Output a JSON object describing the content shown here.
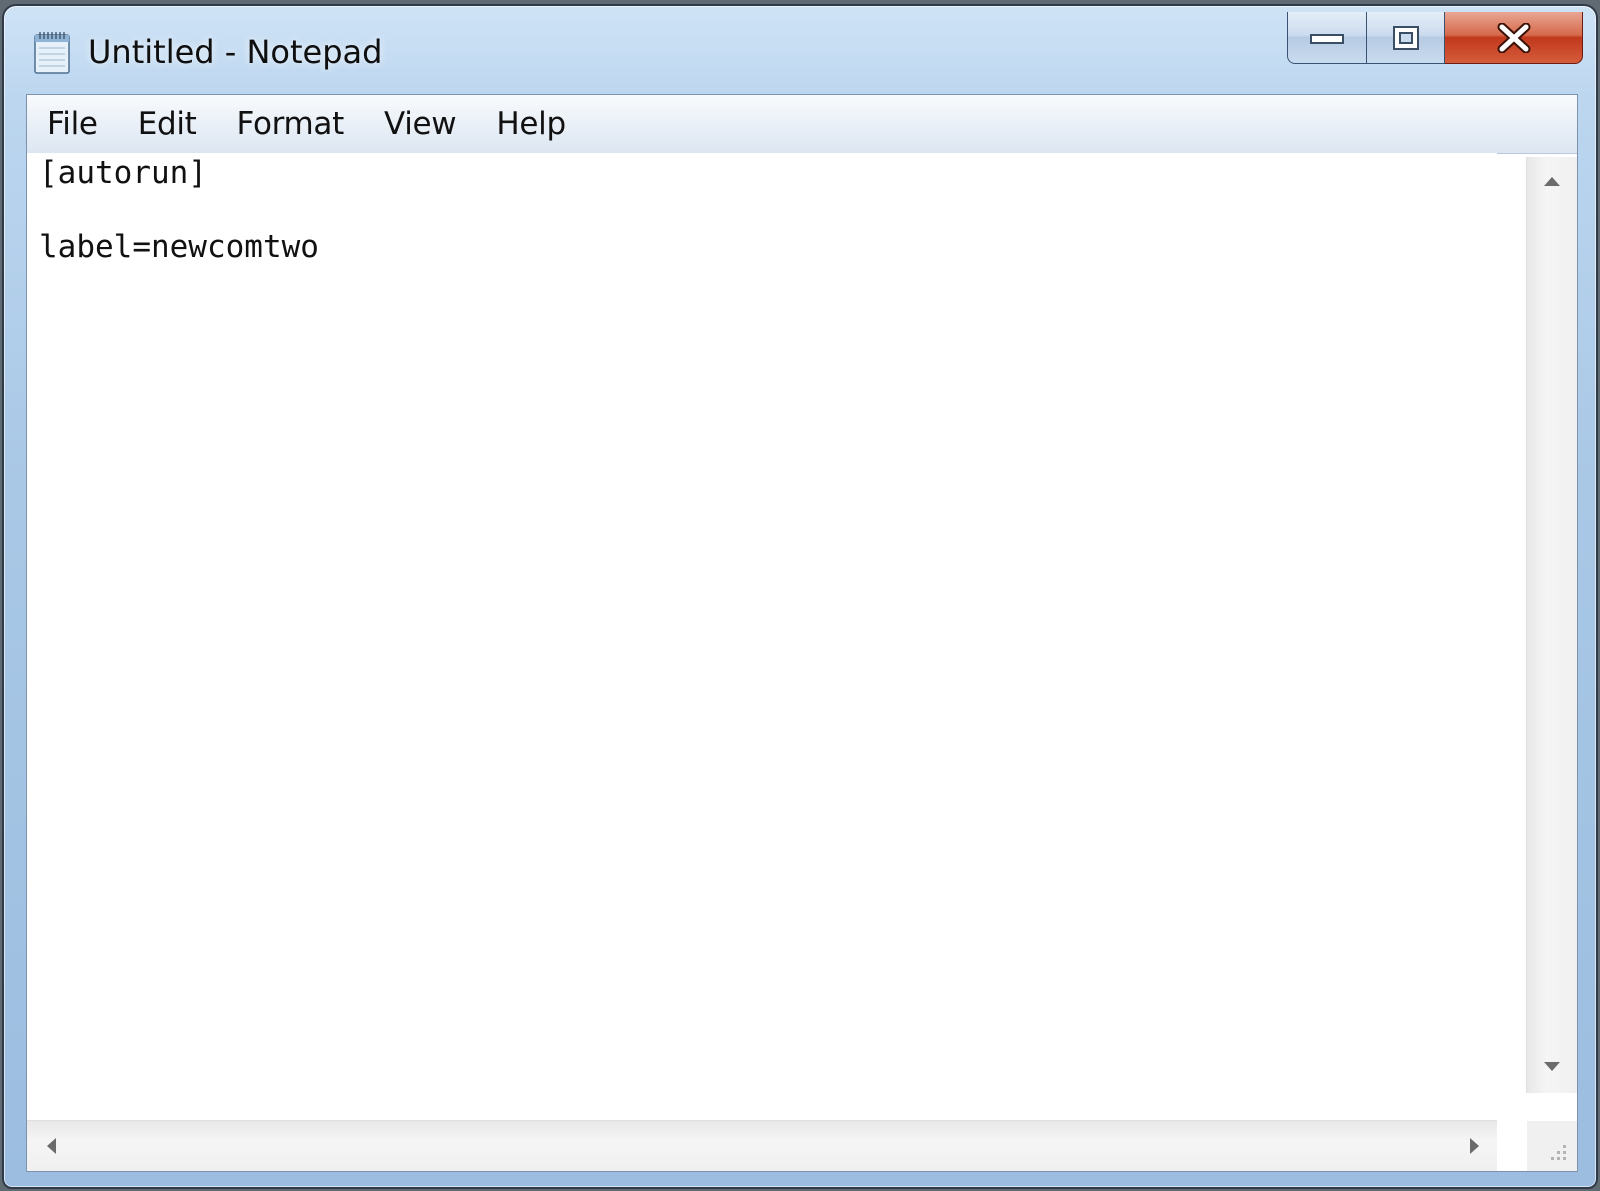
{
  "window": {
    "title": "Untitled - Notepad",
    "app_icon": "notepad-icon"
  },
  "caption": {
    "minimize_icon": "minimize-icon",
    "maximize_icon": "restore-icon",
    "close_label": "X"
  },
  "menu": {
    "items": [
      {
        "label": "File"
      },
      {
        "label": "Edit"
      },
      {
        "label": "Format"
      },
      {
        "label": "View"
      },
      {
        "label": "Help"
      }
    ]
  },
  "editor": {
    "lines": [
      "[autorun]",
      "label=newcomtwo"
    ]
  },
  "scrollbars": {
    "vertical_up_icon": "scroll-up-arrow-icon",
    "vertical_down_icon": "scroll-down-arrow-icon",
    "horizontal_left_icon": "scroll-left-arrow-icon",
    "horizontal_right_icon": "scroll-right-arrow-icon"
  },
  "colors": {
    "title_bar": "#a9c8e6",
    "close_button": "#c1391c",
    "editor_background": "#ffffff"
  }
}
